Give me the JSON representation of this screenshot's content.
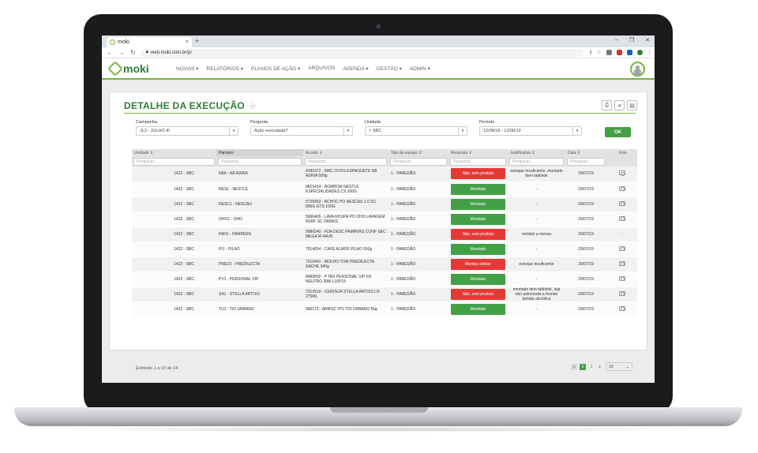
{
  "browser": {
    "tab_title": "moki",
    "tab_close": "×",
    "new_tab": "+",
    "url": "web.moki.com.br/pl",
    "window_controls": [
      "–",
      "❐",
      "✕"
    ]
  },
  "app": {
    "logo_text": "moki",
    "nav": [
      "NOVOS ▾",
      "RELATÓRIOS ▾",
      "PLANOS DE AÇÃO ▾",
      "ARQUIVOS",
      "AGENDA ▾",
      "GESTÃO ▾",
      "ADMIN ▾"
    ]
  },
  "page": {
    "title": "DETALHE DA EXECUÇÃO"
  },
  "filters": {
    "campanha": {
      "label": "Campanha",
      "value": "JL3 - JULHO III"
    },
    "pergunta": {
      "label": "Pergunta",
      "value": "Ação executada?"
    },
    "unidade": {
      "label": "Unidade",
      "value": "× SBC"
    },
    "periodo": {
      "label": "Período",
      "value": "12/08/18 - 12/08/19"
    },
    "ok": "OK"
  },
  "table": {
    "headers": [
      "Unidade ⇕",
      "Parceiro",
      "Acordo ⇕",
      "Tipo de espaço ⇕",
      "Resposta ⇕",
      "Justificativa ⇕",
      "Data ⇕",
      "Foto"
    ],
    "search_placeholder": "Pesquisar",
    "rows": [
      {
        "unidade": "1422 - SBC",
        "parceiro": "N8A - N8 ADRIA",
        "acordo": "4180372 - MAC OVOS ESPAGUETE N8 ADRIA 500g",
        "tipo": "1 - PAREDÃO",
        "resposta": "Não, sem produto",
        "status": "red",
        "just": "estoque insuficiente ,montado item tablóide",
        "data": "29/07/19"
      },
      {
        "unidade": "1422 - SBC",
        "parceiro": "NES1 - NESTLÉ",
        "acordo": "9815414 - BOMBOM NESTLE ESPECIALIDADES CX 300G",
        "tipo": "1 - PAREDÃO",
        "resposta": "Montado",
        "status": "green",
        "just": "-",
        "data": "29/07/19"
      },
      {
        "unidade": "1422 - SBC",
        "parceiro": "NESC1 - NESCAU",
        "acordo": "5725663 - ACHOC PO NESCAU 2.0 SC 800G GTS 100G",
        "tipo": "1 - PAREDÃO",
        "resposta": "Montado",
        "status": "green",
        "just": "-",
        "data": "29/07/19"
      },
      {
        "unidade": "1422 - SBC",
        "parceiro": "OHO1 - OHO",
        "acordo": "5666465 - LAVA ROUPA PO OHO LAVAGEM PERF SC 2400KG",
        "tipo": "1 - PAREDÃO",
        "resposta": "Montado",
        "status": "green",
        "just": "-",
        "data": "29/07/19"
      },
      {
        "unidade": "1422 - SBC",
        "parceiro": "PAH1 - PAMPERS",
        "acordo": "9980040 - FDA DESC PAMPERS CONF SEC MEGA M 44UN",
        "tipo": "1 - PAREDÃO",
        "resposta": "Não, sem produto",
        "status": "red",
        "just": "módulo a menos",
        "data": "29/07/19"
      },
      {
        "unidade": "1422 - SBC",
        "parceiro": "PI1 - PILAO",
        "acordo": "7514654 - CAFE ALMOF PILAO 500g",
        "tipo": "1 - PAREDÃO",
        "resposta": "Montado",
        "status": "green",
        "just": "-",
        "data": "29/07/19"
      },
      {
        "unidade": "1422 - SBC",
        "parceiro": "PRED1 - PREDILECTA",
        "acordo": "7216491 - MOLHO TOM PREDILECTA SACHE 340g",
        "tipo": "1 - PAREDÃO",
        "resposta": "Montou similar",
        "status": "red",
        "just": "estoque insuficiente",
        "data": "29/07/19"
      },
      {
        "unidade": "1422 - SBC",
        "parceiro": "PV1 - PERSONAL VIP",
        "acordo": "8489602 - P HIG PERSONAL VIP FD NEUTRO 30M L16P15",
        "tipo": "1 - PAREDÃO",
        "resposta": "Montado",
        "status": "green",
        "just": "-",
        "data": "29/07/19"
      },
      {
        "unidade": "1422 - SBC",
        "parceiro": "SA1 - STELLA ARTOIS",
        "acordo": "7313519 - CERVEJA STELLA ARTOIS LN 275ML",
        "tipo": "1 - PAREDÃO",
        "resposta": "Não, sem produto",
        "status": "red",
        "just": "montado item tablóide, loja não autorizada a montar bebida alcoólica",
        "data": "29/07/19"
      },
      {
        "unidade": "1422 - SBC",
        "parceiro": "TU1 - TIO URBANO",
        "acordo": "996173 - ARROZ TP1 TIO URBANO 5kg",
        "tipo": "1 - PAREDÃO",
        "resposta": "Montado",
        "status": "green",
        "just": "-",
        "data": "29/07/19"
      }
    ],
    "foto_dash": "-"
  },
  "footer": {
    "info": "Exibindo 1 a 10 de 14",
    "pages": [
      "◂",
      "1",
      "2",
      "▸"
    ],
    "page_size": "10"
  },
  "colors": {
    "accent": "#7cb342",
    "brand": "#2e7d32",
    "danger": "#e53935",
    "success": "#43a047"
  }
}
